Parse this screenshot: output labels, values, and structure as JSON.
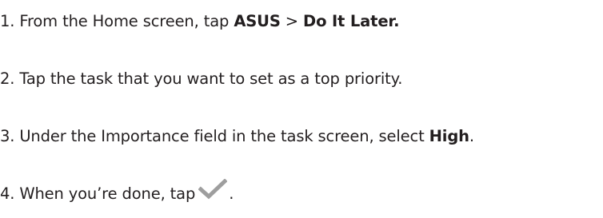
{
  "steps": [
    {
      "number": "1.",
      "text_before": "From the Home screen, tap ",
      "bold_1": "ASUS",
      "separator": " > ",
      "bold_2": "Do It Later."
    },
    {
      "number": "2.",
      "text": "Tap the task that you want to set as a top priority."
    },
    {
      "number": "3.",
      "text_before": "Under the Importance field in the task screen, select ",
      "bold": "High",
      "text_after": "."
    },
    {
      "number": "4.",
      "text_before": "When you’re done, tap",
      "icon": "checkmark-icon",
      "icon_color": "#9e9e9e",
      "text_after": "."
    }
  ]
}
